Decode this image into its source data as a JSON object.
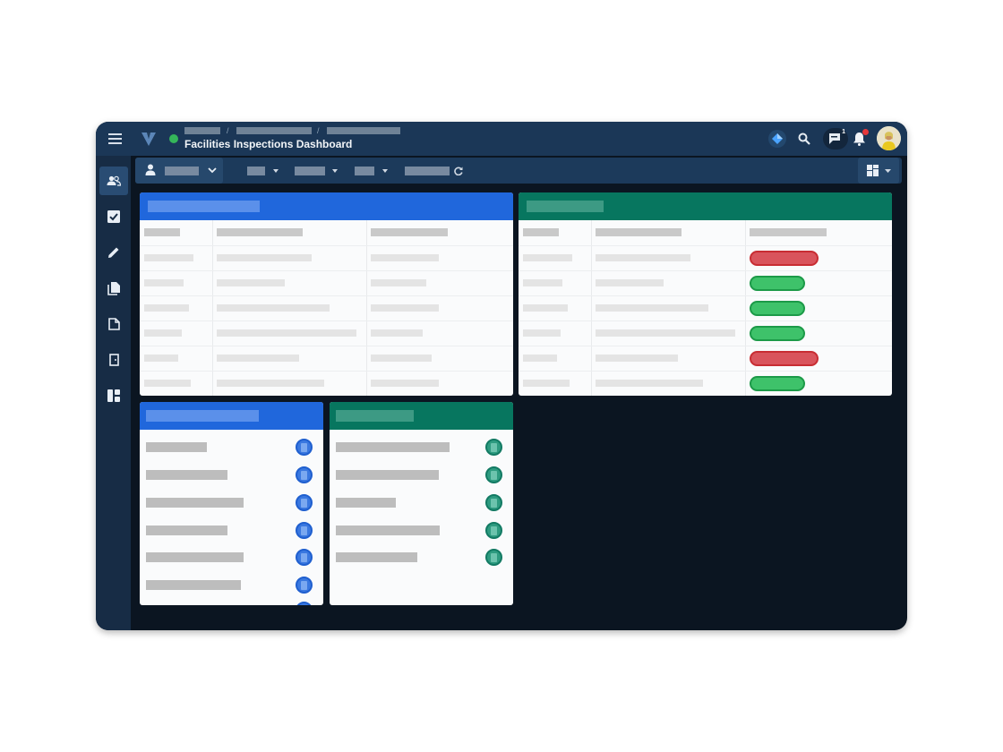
{
  "header": {
    "title": "Facilities Inspections Dashboard",
    "status_color": "#35b65a",
    "notification_count": "1",
    "icons": [
      "menu-icon",
      "app-logo-icon",
      "diamond-icon",
      "search-icon",
      "chat-icon",
      "bell-icon",
      "avatar"
    ]
  },
  "sidebar": {
    "items": [
      "users-icon",
      "checkbox-icon",
      "pencil-icon",
      "documents-icon",
      "document-icon",
      "door-icon",
      "layout-icon"
    ],
    "active_index": 0
  },
  "toolbar": {
    "icons": [
      "user-icon",
      "chevron-down-icon",
      "refresh-icon",
      "layout-grid-icon"
    ]
  },
  "colors": {
    "blue_header": "#2067dc",
    "teal_header": "#07765f",
    "status_fail": "#d9545c",
    "status_pass": "#3ec26a"
  },
  "status_rows": [
    "fail",
    "pass",
    "pass",
    "pass",
    "fail",
    "pass"
  ]
}
